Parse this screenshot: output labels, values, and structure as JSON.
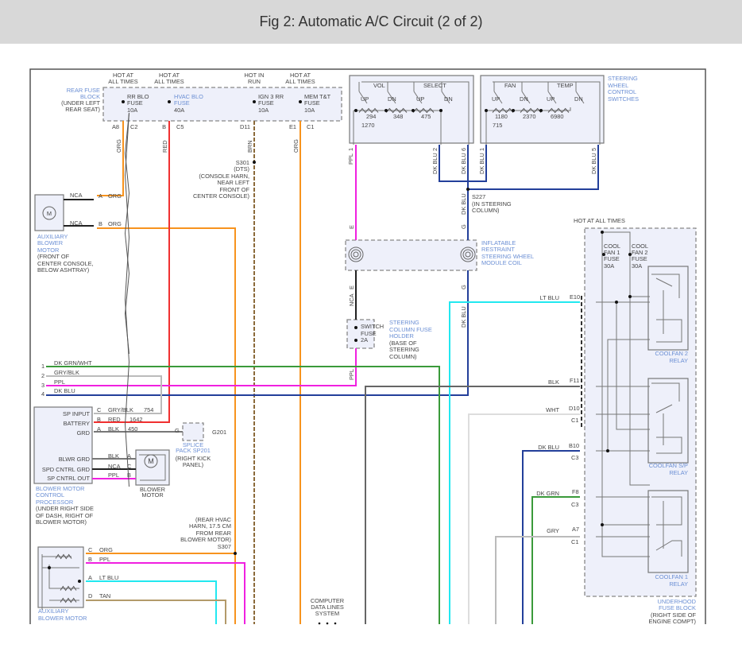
{
  "title": "Fig 2: Automatic A/C Circuit (2 of 2)",
  "colors": {
    "org": "#f7931e",
    "red": "#f03030",
    "brn": "#8b6a3a",
    "ppl": "#f020e0",
    "dkblu": "#233f9a",
    "ltblu": "#22e8f0",
    "dkgrn": "#3a9a3a",
    "gry": "#bbbbbb",
    "blk": "#555555",
    "wht": "#dddddd",
    "tan": "#b39a6a",
    "label_blue": "#6b8fd4"
  },
  "rear_fuse_block": {
    "hot": [
      [
        "HOT AT",
        "ALL TIMES"
      ],
      [
        "HOT AT",
        "ALL TIMES"
      ],
      [
        "HOT IN",
        "RUN"
      ],
      [
        "HOT AT",
        "ALL TIMES"
      ]
    ],
    "name": [
      "REAR FUSE",
      "BLOCK"
    ],
    "location": [
      "(UNDER LEFT",
      "REAR SEAT)"
    ],
    "fuses": [
      [
        "RR BLO",
        "FUSE",
        "10A"
      ],
      [
        "HVAC BLO",
        "FUSE",
        "40A"
      ],
      [
        "IGN 3 RR",
        "FUSE",
        "10A"
      ],
      [
        "MEM T&T",
        "FUSE",
        "10A"
      ]
    ],
    "pins": [
      "A8",
      "C2",
      "B",
      "C5",
      "D11",
      "E1",
      "C1"
    ],
    "wires": [
      "ORG",
      "RED",
      "BRN",
      "ORG"
    ]
  },
  "s301": [
    "S301",
    "(DTS)",
    "(CONSOLE HARN,",
    "NEAR LEFT",
    "FRONT OF",
    "CENTER CONSOLE)"
  ],
  "aux_blower_front": {
    "wires": [
      {
        "circuit": "NCA",
        "pin": "A",
        "color": "ORG"
      },
      {
        "circuit": "NCA",
        "pin": "B",
        "color": "ORG"
      }
    ],
    "motor_glyph": "M",
    "name": [
      "AUXILIARY",
      "BLOWER",
      "MOTOR"
    ],
    "location": [
      "(FRONT OF",
      "CENTER CONSOLE,",
      "BELOW ASHTRAY)"
    ]
  },
  "steering_switches": {
    "left": {
      "groups": [
        "VOL",
        "SELECT"
      ],
      "switches": [
        "UP",
        "DN",
        "UP",
        "DN"
      ],
      "resistors": [
        "294",
        "348",
        "475",
        "1270"
      ]
    },
    "right": {
      "groups": [
        "FAN",
        "TEMP"
      ],
      "switches": [
        "UP",
        "DN",
        "UP",
        "DN"
      ],
      "resistors": [
        "1180",
        "2370",
        "6980",
        "715"
      ]
    },
    "name": [
      "STEERING",
      "WHEEL",
      "CONTROL",
      "SWITCHES"
    ],
    "pins": [
      {
        "pin": "1",
        "color": "PPL"
      },
      {
        "pin": "2",
        "color": "DK BLU"
      },
      {
        "pin": "6",
        "color": "DK BLU"
      },
      {
        "pin": "1",
        "color": "DK BLU"
      },
      {
        "pin": "5",
        "color": "DK BLU"
      }
    ]
  },
  "s227": [
    "S227",
    "(IN STEERING",
    "COLUMN)"
  ],
  "s227_wire": "DK BLU",
  "coil": {
    "pins": [
      "E",
      "G",
      "E",
      "G"
    ],
    "name": [
      "INFLATABLE",
      "RESTRAINT",
      "STEERING WHEEL",
      "MODULE COIL"
    ],
    "wires": [
      "NCA",
      "DK BLU"
    ]
  },
  "fuse_holder": {
    "fuse": [
      "SWITCH",
      "FUSE",
      "2A"
    ],
    "name": [
      "STEERING",
      "COLUMN FUSE",
      "HOLDER"
    ],
    "location": [
      "(BASE OF",
      "STEERING",
      "COLUMN)"
    ],
    "wire": "PPL"
  },
  "harness": [
    {
      "num": "1",
      "label": "DK GRN/WHT"
    },
    {
      "num": "2",
      "label": "GRY/BLK"
    },
    {
      "num": "3",
      "label": "PPL"
    },
    {
      "num": "4",
      "label": "DK BLU"
    }
  ],
  "underhood": {
    "hot": "HOT AT ALL TIMES",
    "fuses": [
      [
        "COOL",
        "FAN 1",
        "FUSE",
        "30A"
      ],
      [
        "COOL",
        "FAN 2",
        "FUSE",
        "30A"
      ]
    ],
    "circuits": [
      {
        "color": "LT BLU",
        "pin": "E10",
        "conn": ""
      },
      {
        "color": "BLK",
        "pin": "F11",
        "conn": ""
      },
      {
        "color": "WHT",
        "pin": "D10",
        "conn": "C1"
      },
      {
        "color": "DK BLU",
        "pin": "B10",
        "conn": "C3"
      },
      {
        "color": "DK GRN",
        "pin": "F8",
        "conn": "C3"
      },
      {
        "color": "GRY",
        "pin": "A7",
        "conn": "C1"
      }
    ],
    "relays": [
      [
        "COOLFAN 2",
        "RELAY"
      ],
      [
        "COOLFAN S/P",
        "RELAY"
      ],
      [
        "COOLFAN 1",
        "RELAY"
      ]
    ],
    "name": [
      "UNDERHOOD",
      "FUSE BLOCK"
    ],
    "location": [
      "(RIGHT SIDE OF",
      "ENGINE COMPT)"
    ]
  },
  "processor": {
    "terminals": [
      "SP INPUT",
      "BATTERY",
      "GRD",
      "BLWR GRD",
      "SPD CNTRL GRD",
      "SP CNTRL OUT"
    ],
    "wires": [
      {
        "pin": "C",
        "color": "GRY/BLK",
        "circuit": "754"
      },
      {
        "pin": "B",
        "color": "RED",
        "circuit": "1642"
      },
      {
        "pin": "A",
        "color": "BLK",
        "circuit": "450"
      }
    ],
    "name": [
      "BLOWER MOTOR",
      "CONTROL",
      "PROCESSOR"
    ],
    "location": [
      "(UNDER RIGHT SIDE",
      "OF DASH, RIGHT OF",
      "BLOWER MOTOR)"
    ]
  },
  "splice": {
    "pin": "G",
    "ground": "G201",
    "name": [
      "SPLICE",
      "PACK SP201"
    ],
    "location": [
      "(RIGHT KICK",
      "PANEL)"
    ]
  },
  "blower_motor": {
    "wires": [
      {
        "color": "BLK",
        "pin": "A"
      },
      {
        "color": "NCA",
        "pin": "C"
      },
      {
        "color": "PPL",
        "pin": "B"
      }
    ],
    "glyph": "M",
    "name": [
      "BLOWER",
      "MOTOR"
    ]
  },
  "s307": [
    "(REAR HVAC",
    "HARN, 17.5 CM",
    "FROM REAR",
    "BLOWER MOTOR)",
    "S307"
  ],
  "aux_blower_rear": {
    "wires": [
      {
        "pin": "C",
        "color": "ORG"
      },
      {
        "pin": "B",
        "color": "PPL"
      },
      {
        "pin": "A",
        "color": "LT BLU"
      },
      {
        "pin": "D",
        "color": "TAN"
      }
    ],
    "name": [
      "AUXILIARY",
      "BLOWER MOTOR"
    ]
  },
  "data_lines": [
    "COMPUTER",
    "DATA LINES",
    "SYSTEM"
  ]
}
